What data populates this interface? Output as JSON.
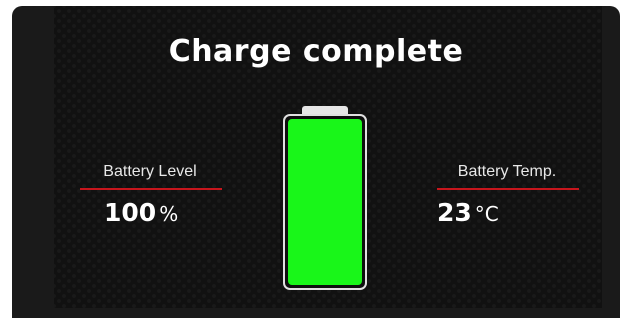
{
  "title": "Charge complete",
  "battery_level": {
    "label": "Battery Level",
    "value": "100",
    "unit": "%"
  },
  "battery_temp": {
    "label": "Battery Temp.",
    "value": "23",
    "unit": "°C"
  },
  "battery_icon": {
    "icon": "battery-full-icon",
    "charge_fraction": 1.0,
    "fill_color": "#19f619"
  },
  "colors": {
    "accent_rule": "#c8161d",
    "background": "#111111"
  }
}
